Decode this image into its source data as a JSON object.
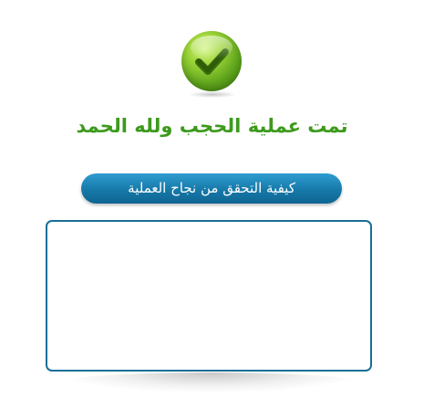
{
  "success": {
    "icon": "checkmark-circle-icon",
    "title": "تمت عملية الحجب ولله الحمد"
  },
  "verify_button": {
    "label": "كيفية التحقق من نجاح العملية"
  },
  "colors": {
    "title_green": "#3d9a1d",
    "button_blue": "#1679a8",
    "box_border": "#1a6e96"
  }
}
